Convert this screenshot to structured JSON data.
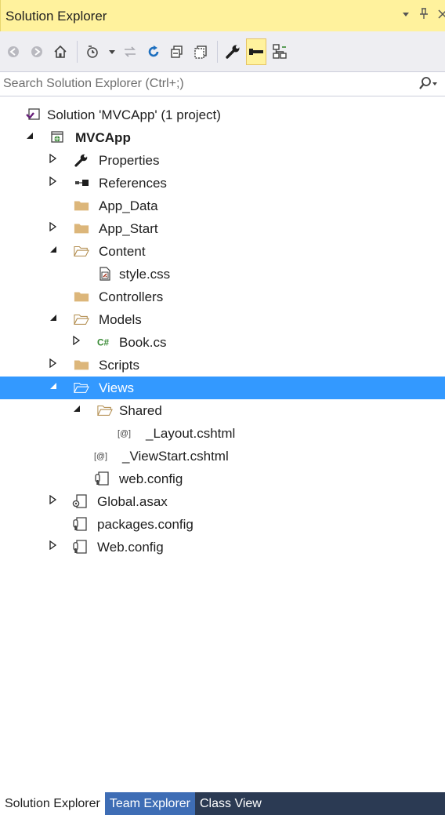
{
  "window": {
    "title": "Solution Explorer",
    "controls": {
      "dropdown": "▾",
      "pin": "ᵖ",
      "close": "×"
    }
  },
  "toolbar": {
    "buttons": [
      "back-icon",
      "forward-icon",
      "home-icon",
      "pending-changes-filter-icon",
      "sync-with-active-document-icon",
      "refresh-icon",
      "collapse-all-icon",
      "show-all-files-icon",
      "properties-icon",
      "preview-selected-items-icon",
      "view-class-diagram-icon"
    ]
  },
  "search": {
    "placeholder": "Search Solution Explorer (Ctrl+;)"
  },
  "tree": [
    {
      "id": "solution",
      "label": "Solution 'MVCApp' (1 project)",
      "level": 0,
      "expander": "none",
      "icon": "solution-icon",
      "bold": false
    },
    {
      "id": "project",
      "label": "MVCApp",
      "level": 0,
      "expander": "expanded",
      "icon": "web-project-icon",
      "bold": true
    },
    {
      "id": "properties",
      "label": "Properties",
      "level": 1,
      "expander": "collapsed",
      "icon": "wrench-icon"
    },
    {
      "id": "references",
      "label": "References",
      "level": 1,
      "expander": "collapsed",
      "icon": "references-icon"
    },
    {
      "id": "app-data",
      "label": "App_Data",
      "level": 1,
      "expander": "none",
      "icon": "folder-icon"
    },
    {
      "id": "app-start",
      "label": "App_Start",
      "level": 1,
      "expander": "collapsed",
      "icon": "folder-icon"
    },
    {
      "id": "content",
      "label": "Content",
      "level": 1,
      "expander": "expanded",
      "icon": "folder-open-icon"
    },
    {
      "id": "style-css",
      "label": "style.css",
      "level": 2,
      "expander": "none",
      "icon": "css-file-icon"
    },
    {
      "id": "controllers",
      "label": "Controllers",
      "level": 1,
      "expander": "none",
      "icon": "folder-icon"
    },
    {
      "id": "models",
      "label": "Models",
      "level": 1,
      "expander": "expanded",
      "icon": "folder-open-icon"
    },
    {
      "id": "book-cs",
      "label": "Book.cs",
      "level": 2,
      "expander": "collapsed",
      "icon": "csharp-file-icon"
    },
    {
      "id": "scripts",
      "label": "Scripts",
      "level": 1,
      "expander": "collapsed",
      "icon": "folder-icon"
    },
    {
      "id": "views",
      "label": "Views",
      "level": 1,
      "expander": "expanded",
      "icon": "folder-open-icon",
      "selected": true
    },
    {
      "id": "shared",
      "label": "Shared",
      "level": 2,
      "expander": "expanded",
      "icon": "folder-open-icon"
    },
    {
      "id": "layout-cshtml",
      "label": "_Layout.cshtml",
      "level": 3,
      "expander": "none",
      "icon": "razor-file-icon"
    },
    {
      "id": "viewstart-cshtml",
      "label": "_ViewStart.cshtml",
      "level": 2,
      "expander": "none",
      "icon": "razor-file-icon"
    },
    {
      "id": "views-web-config",
      "label": "web.config",
      "level": 2,
      "expander": "none",
      "icon": "config-file-icon"
    },
    {
      "id": "global-asax",
      "label": "Global.asax",
      "level": 1,
      "expander": "collapsed",
      "icon": "asax-file-icon"
    },
    {
      "id": "packages-config",
      "label": "packages.config",
      "level": 1,
      "expander": "none",
      "icon": "config-file-icon"
    },
    {
      "id": "web-config",
      "label": "Web.config",
      "level": 1,
      "expander": "collapsed",
      "icon": "config-file-icon"
    }
  ],
  "tabs": [
    {
      "label": "Solution Explorer",
      "active": true
    },
    {
      "label": "Team Explorer",
      "active": false,
      "hot": true
    },
    {
      "label": "Class View",
      "active": false
    }
  ],
  "colors": {
    "title_bar": "#fff29d",
    "toolbar_bg": "#eeeef2",
    "selection": "#3399ff",
    "folder": "#dcb67a",
    "tab_strip": "#2b3a53",
    "icon_blue": "#1e6fbf"
  }
}
